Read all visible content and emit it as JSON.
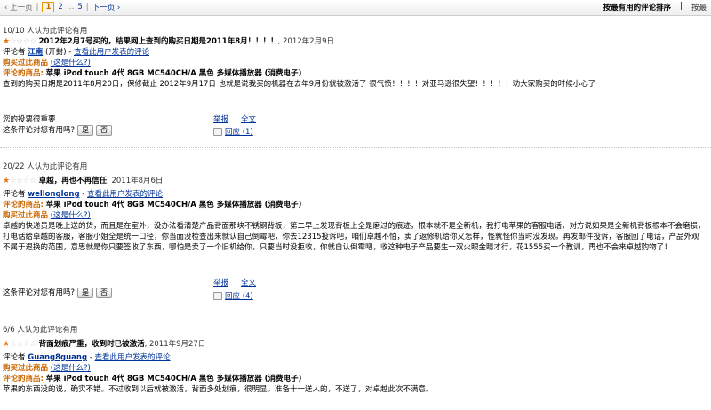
{
  "pager": {
    "prev": "‹ 上一页",
    "pages": [
      "1",
      "2",
      "…",
      "5"
    ],
    "current": "1",
    "next": "下一页 ›"
  },
  "sort": {
    "active": "按最有用的评论排序",
    "separator": "|",
    "other": "按最"
  },
  "reviews": [
    {
      "helpful": "10/10 人认为此评论有用",
      "stars": 1,
      "title": "2012年2月7号买的，结果网上查到的购买日期是2011年8月！！！！",
      "date": ", 2012年2月9日",
      "reviewer_label": "评论者",
      "reviewer": "江南",
      "reviewer_loc": "(开封)",
      "reviewer_link": "查看此用户发表的评论",
      "purchase": "购买过此商品",
      "purchase_hint": "(这是什么?)",
      "product_label": "评论的商品:",
      "product": "苹果 iPod touch 4代 8GB MC540CH/A 黑色 多媒体播放器 (消费电子)",
      "body": "查到的购买日期是2011年8月20日，保修截止 2012年9月17日 也就是说我买的机器在去年9月份就被激活了 很气愤！！！！对亚马逊很失望！！！！！劝大家购买的时候小心了",
      "vote_important": "您的投票很重要",
      "vote_question": "这条评论对您有用吗?",
      "yes": "是",
      "no": "否",
      "report": "举报",
      "permalink": "全文",
      "reply": "回应 (1)"
    },
    {
      "helpful": "20/22 人认为此评论有用",
      "stars": 1,
      "title": "卓越，再也不再信任",
      "date": ", 2011年8月6日",
      "reviewer_label": "评论者",
      "reviewer": "wellonglong",
      "reviewer_loc": "",
      "reviewer_link": "查看此用户发表的评论",
      "purchase": "购买过此商品",
      "purchase_hint": "(这是什么?)",
      "product_label": "评论的商品:",
      "product": "苹果 iPod touch 4代 8GB MC540CH/A 黑色 多媒体播放器 (消费电子)",
      "body": "卓越的快递员是晚上送的货，而且是在室外，没办法看清楚产品背面那块不锈钢背板，第二早上发现背板上全是磨过的痕迹，根本就不是全新机，我打电苹果的客服电话，对方说如果是全新机背板根本不会磨损，打电话给卓越的客服，客服小姐全是统一口径，你当面没检查出来就认自己倒霉吧，你去12315投诉吧，咱们卓越不怕，卖了返修机给你又怎样，怪就怪你当时没发现。再发邮件投诉，客服回了电话，产品外观不属于退换的范围，意思就是你只要签收了东西，哪怕是卖了一个旧机给你，只要当时没拒收，你就自认倒霉吧，收这种电子产品要生一双火眼金睛才行，花1555买一个教训，再也不会来卓越购物了！",
      "vote_important": "",
      "vote_question": "这条评论对您有用吗?",
      "yes": "是",
      "no": "否",
      "report": "举报",
      "permalink": "全文",
      "reply": "回应 (4)"
    },
    {
      "helpful": "6/6 人认为此评论有用",
      "stars": 1,
      "title": "背面划痕严重，收到时已被激活",
      "date": ", 2011年9月27日",
      "reviewer_label": "评论者",
      "reviewer": "Guang8guang",
      "reviewer_loc": "",
      "reviewer_link": "查看此用户发表的评论",
      "purchase": "购买过此商品",
      "purchase_hint": "(这是什么?)",
      "product_label": "评论的商品:",
      "product": "苹果 iPod touch 4代 8GB MC540CH/A 黑色 多媒体播放器 (消费电子)",
      "body": "苹果的东西没的说，确实不错。不过收到以后就被激活，背面多处划痕，很明显。准备十一送人的，不送了，对卓越此次不满意。"
    }
  ],
  "colors": {
    "link": "#003399",
    "star": "#e47911",
    "purchase": "#cc6600"
  },
  "icons": {
    "star": "star-icon",
    "reply": "reply-icon"
  }
}
